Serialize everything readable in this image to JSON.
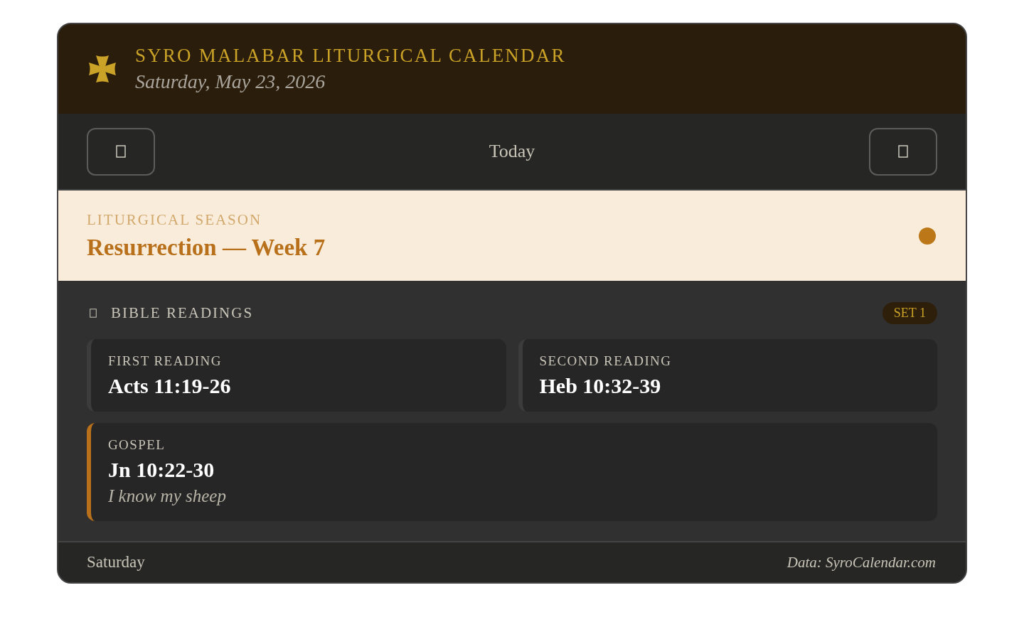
{
  "header": {
    "title": "SYRO MALABAR LITURGICAL CALENDAR",
    "date": "Saturday, May 23, 2026"
  },
  "navigation": {
    "label": "Today"
  },
  "season": {
    "label": "LITURGICAL SEASON",
    "name": "Resurrection — Week 7",
    "color": "#bb7718"
  },
  "readings": {
    "title": "BIBLE READINGS",
    "badge": "SET 1",
    "items": [
      {
        "kind": "reading",
        "label": "FIRST READING",
        "reference": "Acts 11:19-26"
      },
      {
        "kind": "reading",
        "label": "SECOND READING",
        "reference": "Heb 10:32-39"
      },
      {
        "kind": "gospel",
        "label": "GOSPEL",
        "reference": "Jn 10:22-30",
        "subtitle": "I know my sheep"
      }
    ]
  },
  "footer": {
    "day": "Saturday",
    "source": "Data: SyroCalendar.com"
  }
}
